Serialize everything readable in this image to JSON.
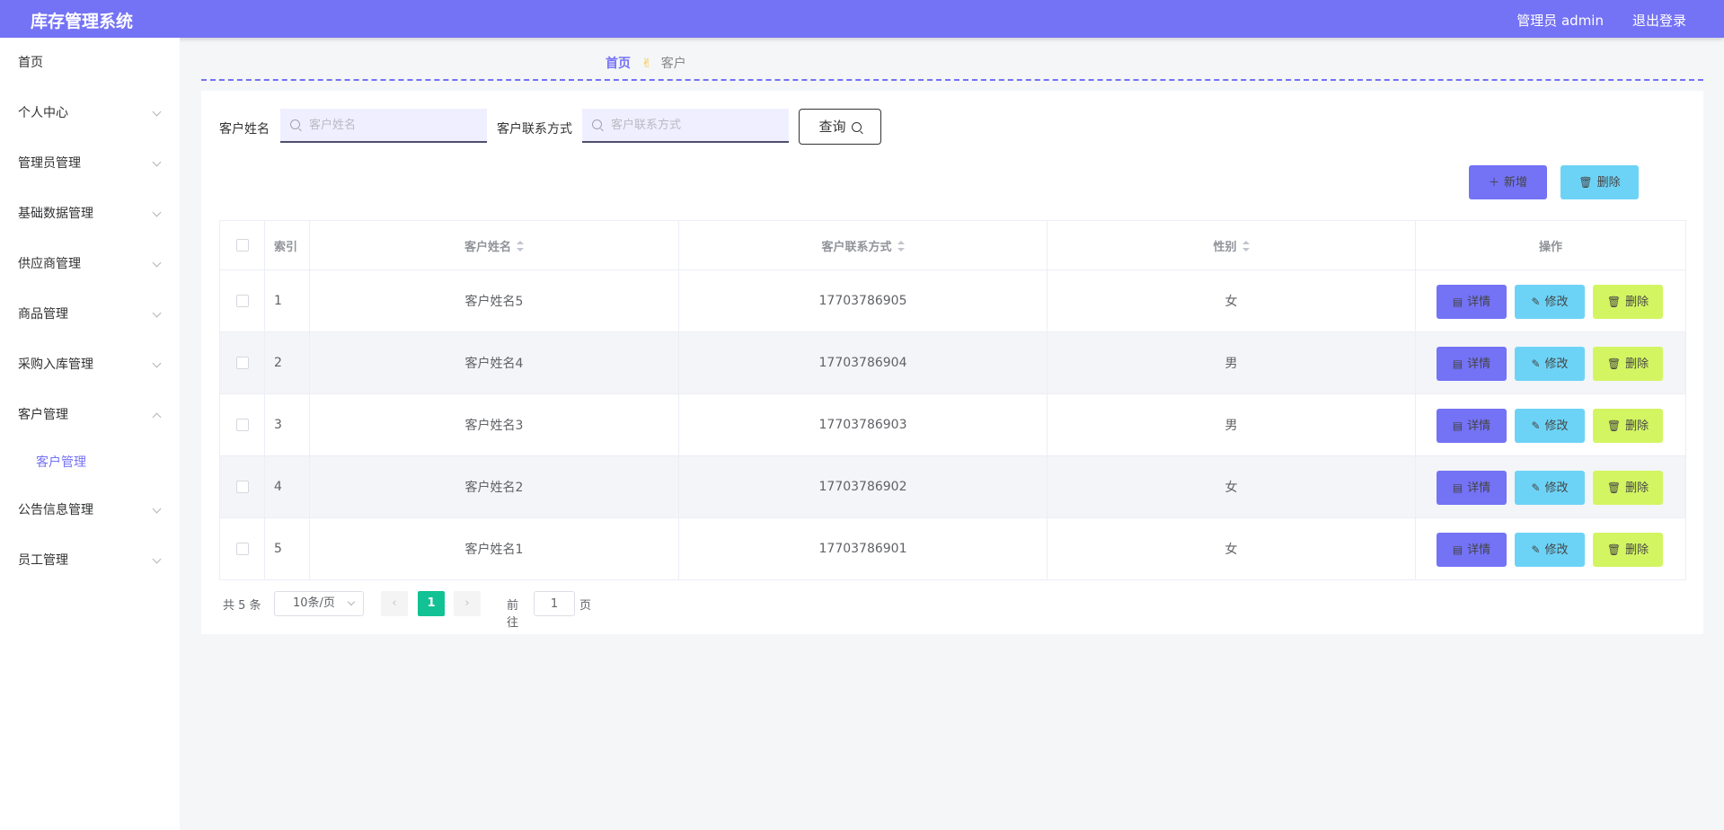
{
  "header": {
    "title": "库存管理系统",
    "admin_label": "管理员 admin",
    "logout_label": "退出登录"
  },
  "sidebar": {
    "items": [
      {
        "label": "首页"
      },
      {
        "label": "个人中心"
      },
      {
        "label": "管理员管理"
      },
      {
        "label": "基础数据管理"
      },
      {
        "label": "供应商管理"
      },
      {
        "label": "商品管理"
      },
      {
        "label": "采购入库管理"
      },
      {
        "label": "客户管理"
      },
      {
        "label": "公告信息管理"
      },
      {
        "label": "员工管理"
      }
    ],
    "submenu": {
      "label": "客户管理"
    }
  },
  "breadcrumb": {
    "home": "首页",
    "separator": "✌",
    "current": "客户"
  },
  "search": {
    "name_label": "客户姓名",
    "name_placeholder": "客户姓名",
    "phone_label": "客户联系方式",
    "phone_placeholder": "客户联系方式",
    "query_label": "查询"
  },
  "actions": {
    "add_label": "新增",
    "delete_label": "删除"
  },
  "table": {
    "columns": [
      "索引",
      "客户姓名",
      "客户联系方式",
      "性别",
      "操作"
    ],
    "rows": [
      {
        "index": "1",
        "name": "客户姓名5",
        "phone": "17703786905",
        "gender": "女"
      },
      {
        "index": "2",
        "name": "客户姓名4",
        "phone": "17703786904",
        "gender": "男"
      },
      {
        "index": "3",
        "name": "客户姓名3",
        "phone": "17703786903",
        "gender": "男"
      },
      {
        "index": "4",
        "name": "客户姓名2",
        "phone": "17703786902",
        "gender": "女"
      },
      {
        "index": "5",
        "name": "客户姓名1",
        "phone": "17703786901",
        "gender": "女"
      }
    ],
    "row_actions": {
      "detail": "详情",
      "edit": "修改",
      "delete": "删除"
    }
  },
  "pagination": {
    "total": "共 5 条",
    "page_size": "10条/页",
    "current_page": "1",
    "goto_prefix": "前往",
    "goto_value": "1",
    "goto_suffix": "页"
  },
  "colors": {
    "primary": "#7472f5",
    "info": "#6dd3f6",
    "warning": "#d3f562",
    "page_active": "#12c294"
  }
}
